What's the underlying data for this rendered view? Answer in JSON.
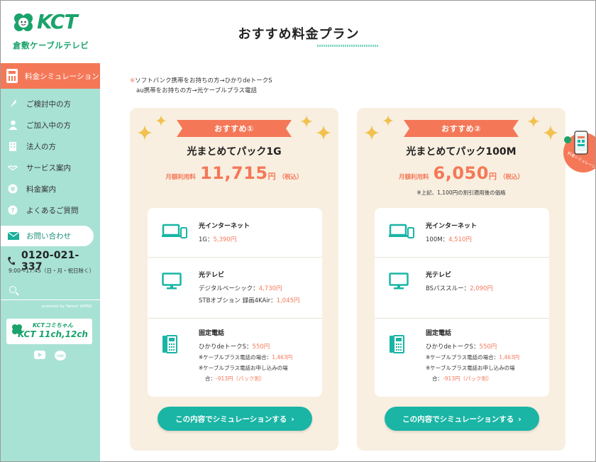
{
  "logo": {
    "brand": "KCT",
    "name": "倉敷ケーブルテレビ"
  },
  "sidebar": {
    "simulation_label": "料金シミュレーション",
    "items": [
      {
        "label": "ご検討中の方",
        "icon": "leaf-icon"
      },
      {
        "label": "ご加入中の方",
        "icon": "person-icon"
      },
      {
        "label": "法人の方",
        "icon": "building-icon"
      },
      {
        "label": "サービス案内",
        "icon": "handshake-icon"
      },
      {
        "label": "料金案内",
        "icon": "yen-icon"
      },
      {
        "label": "よくあるご質問",
        "icon": "question-icon"
      }
    ],
    "contact_label": "お問い合わせ",
    "tel": "0120-021-337",
    "hours": "9:00〜17:45（日・月・祝日除く）",
    "powered": "powered by Yahoo! JAPAN",
    "banner_line1": "KCTコミちゃん",
    "banner_line2": "KCT 11ch,12ch"
  },
  "main": {
    "title": "おすすめ料金プラン",
    "note_line1": "※ソフトバンク携帯をお持ちの方→ひかりdeトークS",
    "note_line2": "au携帯をお持ちの方→光ケーブルプラス電話",
    "note_mark": "※"
  },
  "plans": [
    {
      "badge": "おすすめ①",
      "name": "光まとめてパック1G",
      "price_prefix": "月額利用料",
      "price": "11,715",
      "yen": "円",
      "tax": "（税込）",
      "price_note": "",
      "internet": {
        "title": "光インターネット",
        "item": "1G：",
        "price": "5,390円"
      },
      "tv": {
        "title": "光テレビ",
        "lines": [
          {
            "item": "デジタルベーシック：",
            "price": "4,730円"
          },
          {
            "item": "STBオプション 録画4KAir：",
            "price": "1,045円"
          }
        ]
      },
      "phone": {
        "title": "固定電話",
        "item": "ひかりdeトークS：",
        "price": "550円",
        "note1": "※ケーブルプラス電話の場合：",
        "note1_price": "1,463円",
        "note2": "※ケーブルプラス電話お申し込みの場",
        "note3": "合：",
        "note3_price": "-913円（パック割）"
      },
      "cta": "この内容でシミュレーションする"
    },
    {
      "badge": "おすすめ②",
      "name": "光まとめてパック100M",
      "price_prefix": "月額利用料",
      "price": "6,050",
      "yen": "円",
      "tax": "（税込）",
      "price_note": "※上記、1,100円の割引適用後の価格",
      "internet": {
        "title": "光インターネット",
        "item": "100M：",
        "price": "4,510円"
      },
      "tv": {
        "title": "光テレビ",
        "lines": [
          {
            "item": "BSパススルー：",
            "price": "2,090円"
          }
        ]
      },
      "phone": {
        "title": "固定電話",
        "item": "ひかりdeトークS：",
        "price": "550円",
        "note1": "※ケーブルプラス電話の場合：",
        "note1_price": "1,463円",
        "note2": "※ケーブルプラス電話お申し込みの場",
        "note3": "合：",
        "note3_price": "-913円（パック割）"
      },
      "cta": "この内容でシミュレーションする"
    }
  ],
  "float_badge": {
    "label": "料金シミュレーション"
  },
  "colors": {
    "accent": "#f47858",
    "teal": "#1ab5a5",
    "sidebar": "#a8e2d4",
    "card": "#f8efe0"
  }
}
